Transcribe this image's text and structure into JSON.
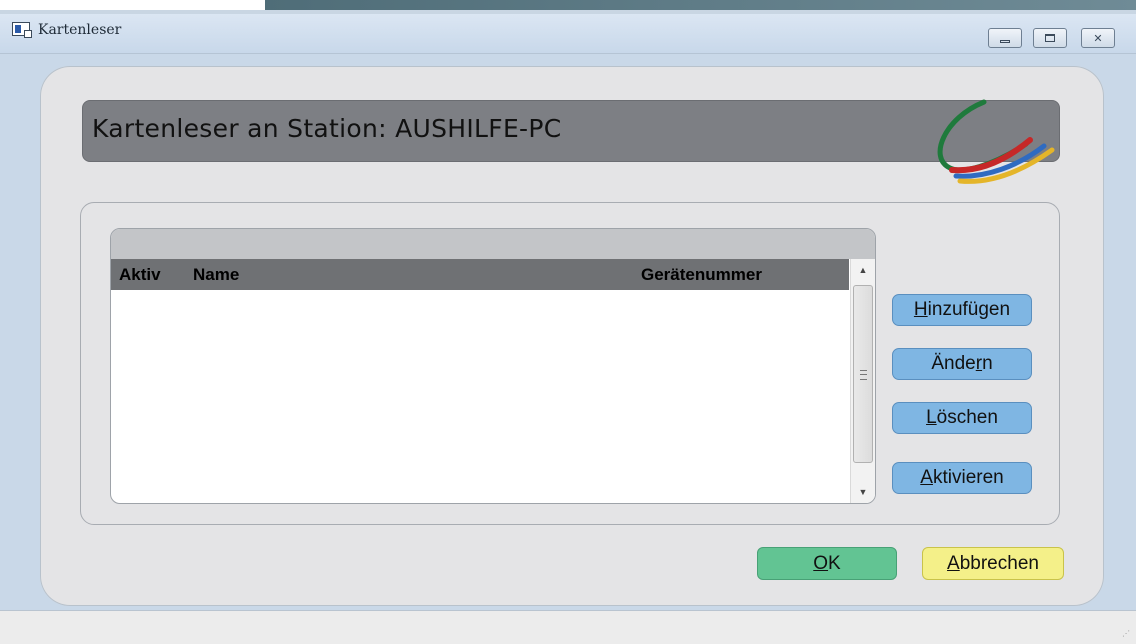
{
  "window": {
    "title": "Kartenleser"
  },
  "header": {
    "title": "Kartenleser an Station: AUSHILFE-PC"
  },
  "list": {
    "columns": [
      "Aktiv",
      "Name",
      "Gerätenummer"
    ],
    "rows": []
  },
  "side_buttons": {
    "add": {
      "accel": "H",
      "rest": "inzufügen"
    },
    "change": {
      "pre": "Ände",
      "accel": "r",
      "rest": "n"
    },
    "delete": {
      "accel": "L",
      "rest": "öschen"
    },
    "activate": {
      "accel": "A",
      "rest": "ktivieren"
    }
  },
  "footer_buttons": {
    "ok": {
      "accel": "O",
      "rest": "K"
    },
    "cancel": {
      "accel": "A",
      "rest": "bbrechen"
    }
  },
  "colors": {
    "side_button": "#7fb6e3",
    "ok_button": "#62c493",
    "cancel_button": "#f4f089",
    "header_banner": "#7d7f84"
  },
  "icons": {
    "window": "app-window-icon",
    "logo": "swoosh-logo"
  }
}
